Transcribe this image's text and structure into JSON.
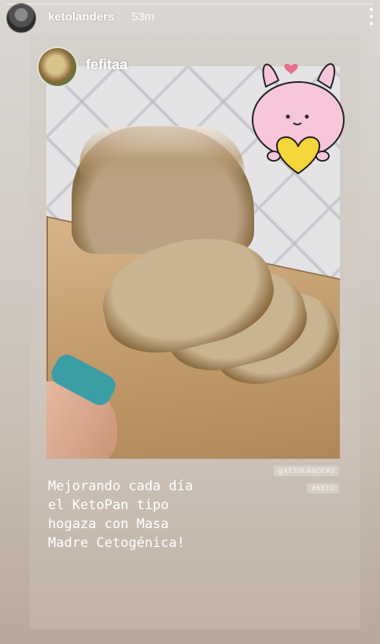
{
  "story": {
    "username": "ketolanders",
    "time_ago": "53m",
    "more_icon": "more-vertical-icon"
  },
  "shared_post": {
    "original_author": "fefitaa",
    "caption": "Mejorando cada día\nel KetoPan tipo\nhogaza con Masa\nMadre Cetogénica!",
    "tags": [
      "@KETOLANDERS",
      "#KETO"
    ]
  },
  "colors": {
    "watch_band": "#3c9ea5",
    "sticker_pink": "#f7c6db",
    "sticker_heart": "#f5d63a"
  }
}
